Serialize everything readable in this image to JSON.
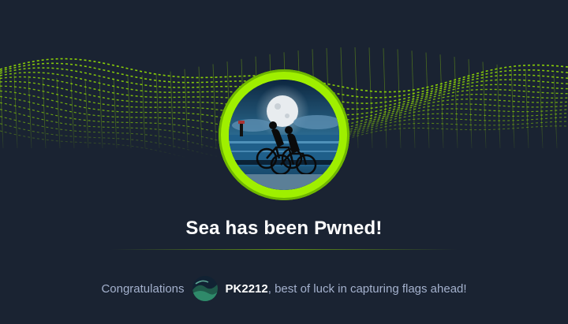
{
  "achievement": {
    "title": "Sea has been Pwned!",
    "badge_icon": "cyclists-moon-icon"
  },
  "message": {
    "prefix": "Congratulations",
    "username": "PK2212",
    "suffix": ", best of luck in capturing flags ahead!"
  },
  "colors": {
    "background": "#1a2332",
    "accent": "#9fef00",
    "muted_text": "#a4b1cd",
    "title_text": "#ffffff"
  }
}
